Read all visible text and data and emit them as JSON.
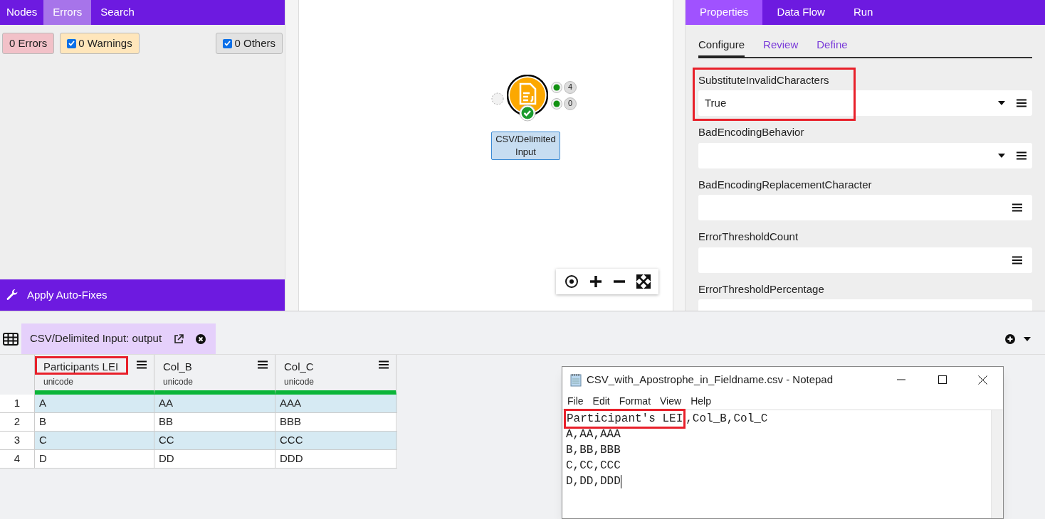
{
  "left_panel": {
    "tabs": [
      {
        "label": "Nodes",
        "selected": false
      },
      {
        "label": "Errors",
        "selected": true
      },
      {
        "label": "Search",
        "selected": false
      }
    ],
    "filters": [
      {
        "label": "0 Errors",
        "kind": "plain",
        "color": "#f2c1c8"
      },
      {
        "label": "0 Warnings",
        "kind": "checkbox",
        "checked": true,
        "color": "#ffe6bb"
      },
      {
        "label": "0 Others",
        "kind": "checkbox",
        "checked": true,
        "color": "#e2e2e2"
      }
    ],
    "apply_button": "Apply Auto-Fixes"
  },
  "canvas": {
    "node": {
      "label": "CSV/Delimited Input",
      "outputs": [
        "4",
        "0"
      ]
    }
  },
  "right_panel": {
    "tabs": [
      {
        "label": "Properties",
        "selected": true
      },
      {
        "label": "Data Flow",
        "selected": false
      },
      {
        "label": "Run",
        "selected": false
      }
    ],
    "subtabs": [
      {
        "label": "Configure",
        "selected": true
      },
      {
        "label": "Review",
        "selected": false
      },
      {
        "label": "Define",
        "selected": false
      }
    ],
    "properties": [
      {
        "label": "SubstituteInvalidCharacters",
        "kind": "dropdown",
        "value": "True",
        "highlighted": true
      },
      {
        "label": "BadEncodingBehavior",
        "kind": "dropdown",
        "highlighted": false
      },
      {
        "label": "BadEncodingReplacementCharacter",
        "kind": "text",
        "highlighted": false
      },
      {
        "label": "ErrorThresholdCount",
        "kind": "text",
        "highlighted": false
      },
      {
        "label": "ErrorThresholdPercentage",
        "kind": "text",
        "highlighted": false
      }
    ]
  },
  "output": {
    "tab": "CSV/Delimited Input: output",
    "columns": [
      {
        "name": "Participants LEI",
        "type": "unicode",
        "highlighted": true
      },
      {
        "name": "Col_B",
        "type": "unicode",
        "highlighted": false
      },
      {
        "name": "Col_C",
        "type": "unicode",
        "highlighted": false
      }
    ],
    "rows": [
      {
        "number": "1",
        "cells": [
          "A",
          "AA",
          "AAA"
        ]
      },
      {
        "number": "2",
        "cells": [
          "B",
          "BB",
          "BBB"
        ]
      },
      {
        "number": "3",
        "cells": [
          "C",
          "CC",
          "CCC"
        ]
      },
      {
        "number": "4",
        "cells": [
          "D",
          "DD",
          "DDD"
        ]
      }
    ]
  },
  "notepad": {
    "title": "CSV_with_Apostrophe_in_Fieldname.csv - Notepad",
    "menu": [
      "File",
      "Edit",
      "Format",
      "View",
      "Help"
    ],
    "lines": [
      {
        "highlight": "Participant's LEI",
        "rest": ",Col_B,Col_C"
      },
      {
        "rest": "A,AA,AAA"
      },
      {
        "rest": "B,BB,BBB"
      },
      {
        "rest": "C,CC,CCC"
      },
      {
        "rest": "D,DD,DDD"
      }
    ]
  }
}
